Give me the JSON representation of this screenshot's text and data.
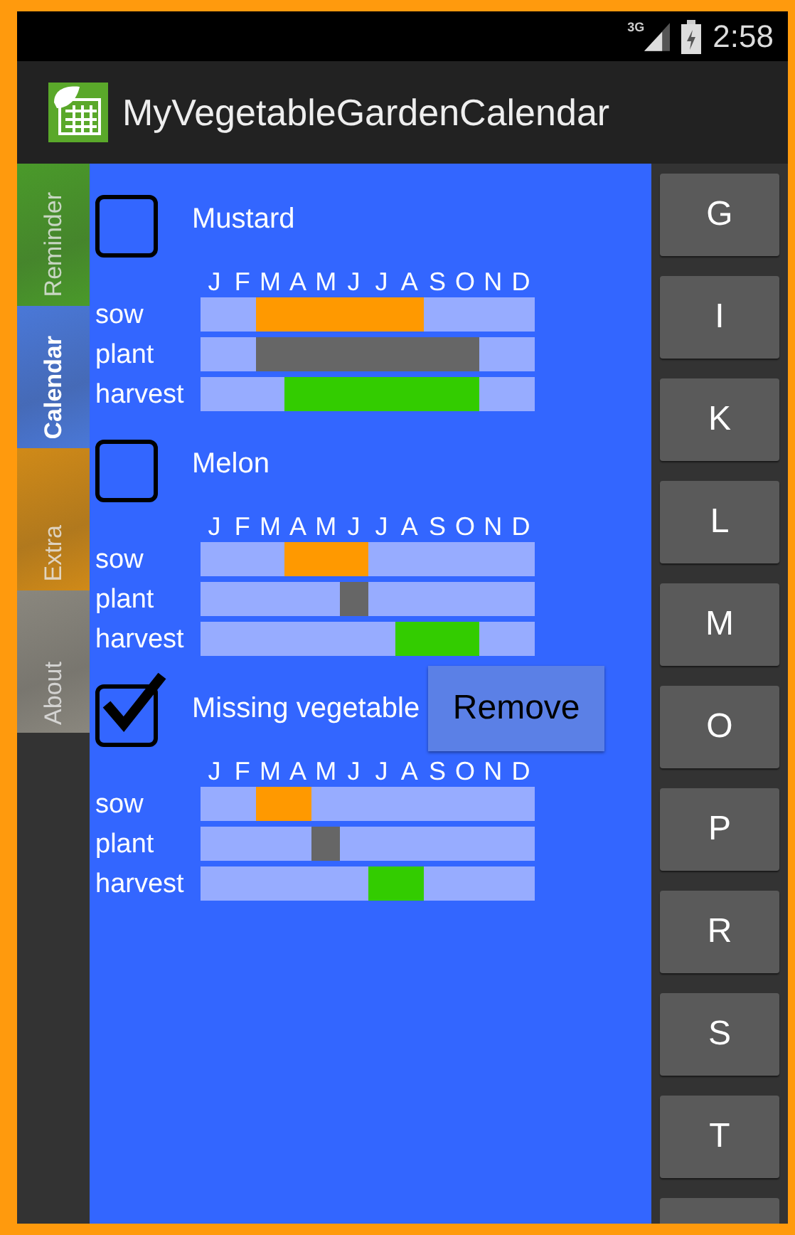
{
  "status_bar": {
    "network": "3G",
    "time": "2:58"
  },
  "app_bar": {
    "title": "MyVegetableGardenCalendar"
  },
  "side_tabs": [
    {
      "label": "Reminder",
      "selected": false,
      "color": "#4a9a2a"
    },
    {
      "label": "Calendar",
      "selected": true,
      "color": "#4a78d8"
    },
    {
      "label": "Extra",
      "selected": false,
      "color": "#d08a18"
    },
    {
      "label": "About",
      "selected": false,
      "color": "#8a877e"
    }
  ],
  "vegetables": [
    {
      "name": "Mustard",
      "checked": false,
      "month_labels": [
        "J",
        "F",
        "M",
        "A",
        "M",
        "J",
        "J",
        "A",
        "S",
        "O",
        "N",
        "D"
      ],
      "rows": [
        {
          "kind": "sow",
          "label": "sow",
          "months": [
            false,
            false,
            true,
            true,
            true,
            true,
            true,
            true,
            false,
            false,
            false,
            false
          ]
        },
        {
          "kind": "plant",
          "label": "plant",
          "months": [
            false,
            false,
            true,
            true,
            true,
            true,
            true,
            true,
            true,
            true,
            false,
            false
          ]
        },
        {
          "kind": "harvest",
          "label": "harvest",
          "months": [
            false,
            false,
            false,
            true,
            true,
            true,
            true,
            true,
            true,
            true,
            false,
            false
          ]
        }
      ]
    },
    {
      "name": "Melon",
      "checked": false,
      "month_labels": [
        "J",
        "F",
        "M",
        "A",
        "M",
        "J",
        "J",
        "A",
        "S",
        "O",
        "N",
        "D"
      ],
      "rows": [
        {
          "kind": "sow",
          "label": "sow",
          "months": [
            false,
            false,
            false,
            true,
            true,
            true,
            false,
            false,
            false,
            false,
            false,
            false
          ]
        },
        {
          "kind": "plant",
          "label": "plant",
          "months": [
            false,
            false,
            false,
            false,
            false,
            true,
            false,
            false,
            false,
            false,
            false,
            false
          ]
        },
        {
          "kind": "harvest",
          "label": "harvest",
          "months": [
            false,
            false,
            false,
            false,
            false,
            false,
            false,
            true,
            true,
            true,
            false,
            false
          ]
        }
      ]
    },
    {
      "name": "Missing vegetable",
      "checked": true,
      "action": "Remove",
      "month_labels": [
        "J",
        "F",
        "M",
        "A",
        "M",
        "J",
        "J",
        "A",
        "S",
        "O",
        "N",
        "D"
      ],
      "rows": [
        {
          "kind": "sow",
          "label": "sow",
          "months": [
            false,
            false,
            true,
            true,
            false,
            false,
            false,
            false,
            false,
            false,
            false,
            false
          ]
        },
        {
          "kind": "plant",
          "label": "plant",
          "months": [
            false,
            false,
            false,
            false,
            true,
            false,
            false,
            false,
            false,
            false,
            false,
            false
          ]
        },
        {
          "kind": "harvest",
          "label": "harvest",
          "months": [
            false,
            false,
            false,
            false,
            false,
            false,
            true,
            true,
            false,
            false,
            false,
            false
          ]
        }
      ]
    }
  ],
  "index_buttons": [
    "G",
    "I",
    "K",
    "L",
    "M",
    "O",
    "P",
    "R",
    "S",
    "T"
  ]
}
